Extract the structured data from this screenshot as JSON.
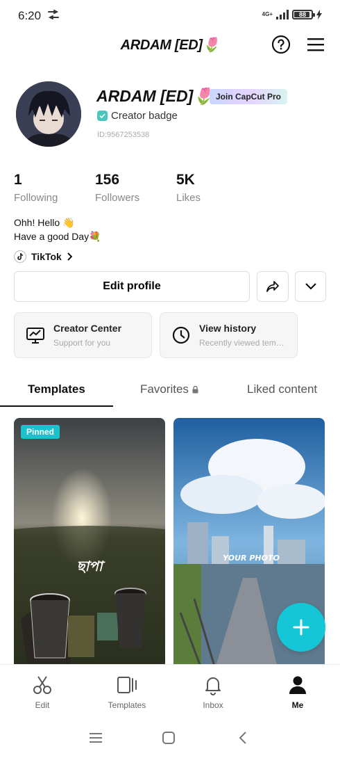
{
  "status_bar": {
    "time": "6:20",
    "network": "4G+",
    "battery": "88"
  },
  "header": {
    "title": "ARDAM [ED]🌷",
    "help_icon": "help-circle-icon",
    "menu_icon": "hamburger-menu-icon"
  },
  "profile": {
    "name": "ARDAM [ED]🌷",
    "pro_badge": "Join CapCut Pro",
    "creator_badge": "Creator badge",
    "id": "ID:9567253538",
    "bio_line1": "Ohh! Hello 👋",
    "bio_line2": "Have a good Day💐",
    "tiktok_label": "TikTok"
  },
  "stats": [
    {
      "value": "1",
      "label": "Following"
    },
    {
      "value": "156",
      "label": "Followers"
    },
    {
      "value": "5K",
      "label": "Likes"
    }
  ],
  "actions": {
    "edit_profile": "Edit profile",
    "share_icon": "share-arrow-icon",
    "more_icon": "chevron-down-icon"
  },
  "cards": [
    {
      "title": "Creator Center",
      "subtitle": "Support for you",
      "icon": "monitor-chart-icon"
    },
    {
      "title": "View history",
      "subtitle": "Recently viewed templates",
      "icon": "clock-icon"
    }
  ],
  "tabs": [
    {
      "label": "Templates",
      "active": true
    },
    {
      "label": "Favorites",
      "lock": true
    },
    {
      "label": "Liked content"
    }
  ],
  "thumbnails": [
    {
      "badge": "Pinned",
      "overlay_text": "ছাপা"
    },
    {
      "overlay_text": "YOUR PHOTO"
    }
  ],
  "bottom_nav": [
    {
      "label": "Edit",
      "icon": "scissors-icon"
    },
    {
      "label": "Templates",
      "icon": "templates-icon"
    },
    {
      "label": "Inbox",
      "icon": "bell-icon"
    },
    {
      "label": "Me",
      "icon": "person-icon",
      "active": true
    }
  ],
  "colors": {
    "accent": "#15c6d6",
    "pinned": "#19c2cd",
    "creator_badge": "#4cc6bc"
  }
}
